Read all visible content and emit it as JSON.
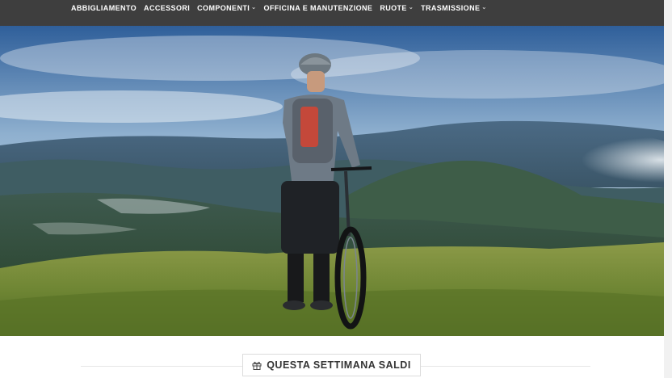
{
  "nav": {
    "items": [
      {
        "label": "ABBIGLIAMENTO",
        "has_dropdown": false
      },
      {
        "label": "ACCESSORI",
        "has_dropdown": false
      },
      {
        "label": "COMPONENTI",
        "has_dropdown": true
      },
      {
        "label": "OFFICINA E MANUTENZIONE",
        "has_dropdown": false
      },
      {
        "label": "RUOTE",
        "has_dropdown": true
      },
      {
        "label": "TRASMISSIONE",
        "has_dropdown": true
      }
    ],
    "background": "#3e3e3e",
    "text_color": "#ffffff"
  },
  "hero": {
    "image": "mountain-biker-landscape"
  },
  "section": {
    "title": "QUESTA SETTIMANA SALDI",
    "icon": "gift-icon"
  }
}
